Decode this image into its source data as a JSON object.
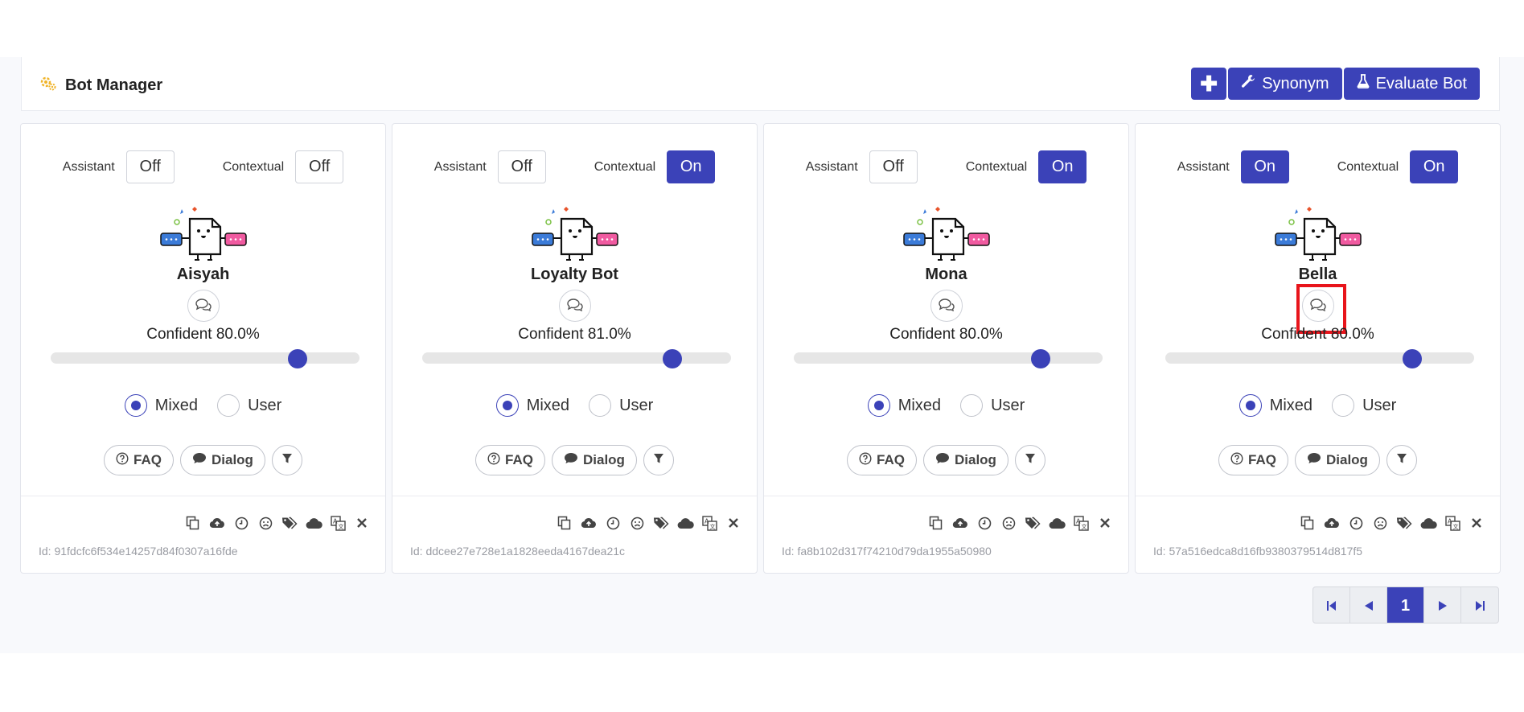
{
  "header": {
    "title": "Bot Manager",
    "synonym_label": "Synonym",
    "evaluate_label": "Evaluate Bot",
    "add_icon": "plus-icon",
    "synonym_icon": "wrench-icon",
    "evaluate_icon": "flask-icon"
  },
  "labels": {
    "assistant": "Assistant",
    "contextual": "Contextual",
    "mixed": "Mixed",
    "user": "User",
    "faq": "FAQ",
    "dialog": "Dialog"
  },
  "bots": [
    {
      "name": "Aisyah",
      "assistant": "Off",
      "contextual": "Off",
      "confident_text": "Confident 80.0%",
      "confidence": 0.8,
      "mode": "Mixed",
      "id_text": "Id: 91fdcfc6f534e14257d84f0307a16fde"
    },
    {
      "name": "Loyalty Bot",
      "assistant": "Off",
      "contextual": "On",
      "confident_text": "Confident 81.0%",
      "confidence": 0.81,
      "mode": "Mixed",
      "id_text": "Id: ddcee27e728e1a1828eeda4167dea21c"
    },
    {
      "name": "Mona",
      "assistant": "Off",
      "contextual": "On",
      "confident_text": "Confident 80.0%",
      "confidence": 0.8,
      "mode": "Mixed",
      "id_text": "Id: fa8b102d317f74210d79da1955a50980"
    },
    {
      "name": "Bella",
      "assistant": "On",
      "contextual": "On",
      "confident_text": "Confident 80.0%",
      "confidence": 0.8,
      "mode": "Mixed",
      "id_text": "Id: 57a516edca8d16fb9380379514d817f5"
    }
  ],
  "footer_icons": [
    "copy-icon",
    "cloud-upload-icon",
    "clock-icon",
    "frown-icon",
    "tags-icon",
    "cloud-icon",
    "translate-icon",
    "close-icon"
  ],
  "pagination": {
    "current": "1"
  },
  "colors": {
    "accent": "#3b42b8",
    "highlight": "#e8141b"
  }
}
